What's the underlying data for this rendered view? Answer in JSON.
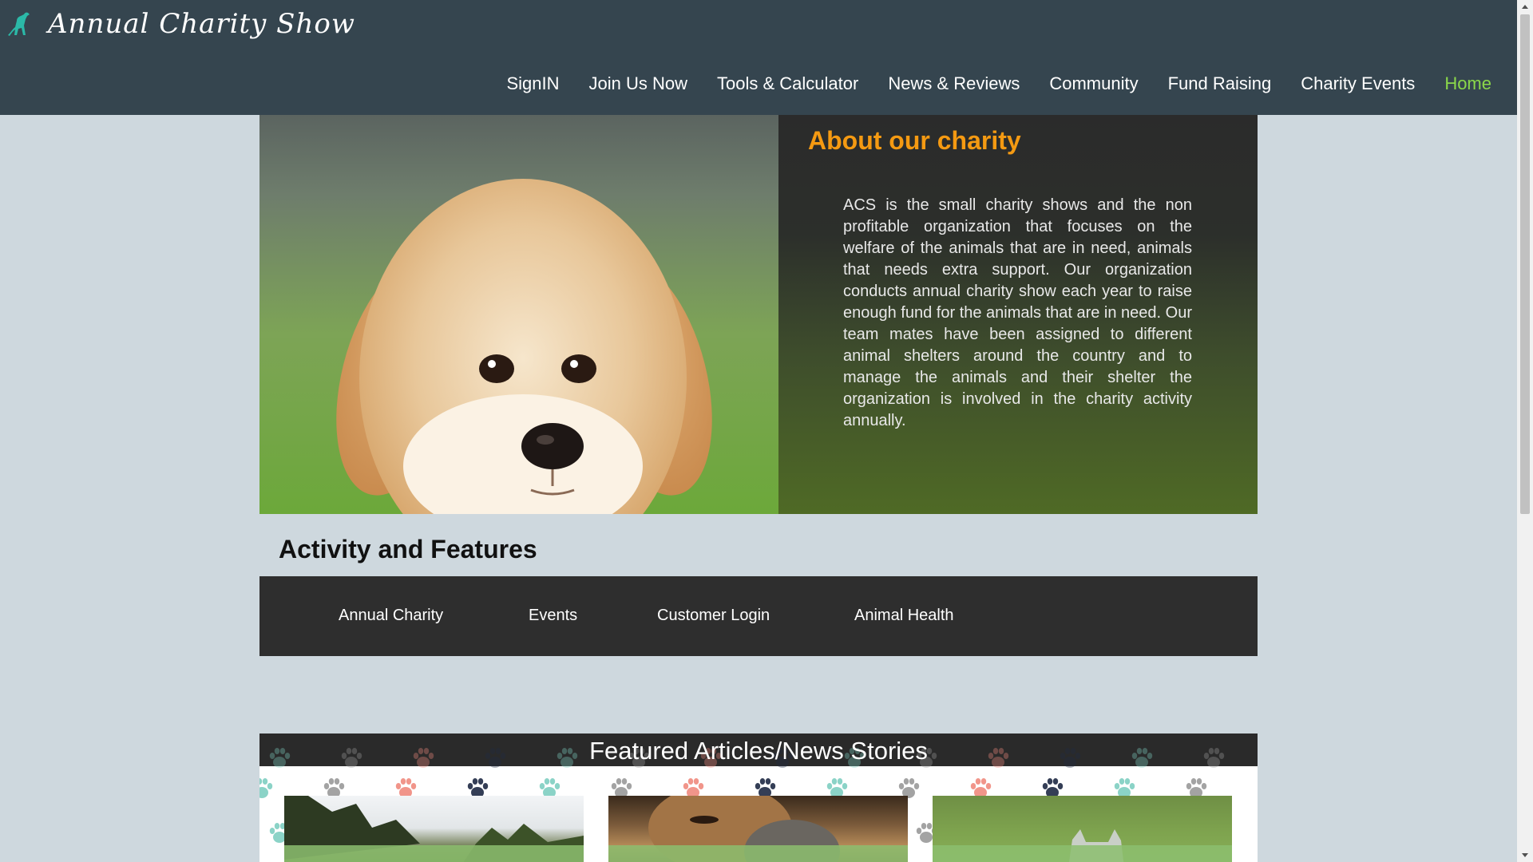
{
  "header": {
    "title": "Annual Charity Show",
    "logo_icon": "dog-icon",
    "background": "#35454f",
    "nav": [
      {
        "label": "SignIN"
      },
      {
        "label": "Join Us Now"
      },
      {
        "label": "Tools & Calculator"
      },
      {
        "label": "News & Reviews"
      },
      {
        "label": "Community"
      },
      {
        "label": "Fund Raising"
      },
      {
        "label": "Charity Events"
      },
      {
        "label": "Home",
        "active": true
      }
    ],
    "active_color": "#8bd84a"
  },
  "hero": {
    "image": "golden-retriever-puppy",
    "title": "About our charity",
    "title_color": "#f59a12",
    "body": "ACS is the small charity shows and the non profitable organization that focuses on the welfare of the animals that are in need, animals that needs extra support. Our organization conducts annual charity show each year to raise enough fund for the animals that are in need. Our team mates have been assigned to different animal shelters around the country and to manage the animals and their shelter the organization is involved in the charity activity annually."
  },
  "activity": {
    "title": "Activity and Features",
    "items": [
      {
        "label": "Annual Charity"
      },
      {
        "label": "Events"
      },
      {
        "label": "Customer Login"
      },
      {
        "label": "Animal Health"
      }
    ]
  },
  "featured": {
    "title": "Featured Articles/News Stories",
    "paw_colors": [
      "#7fcfc1",
      "#9a9a9a",
      "#f08a7e",
      "#1f2a44"
    ],
    "cards": [
      {
        "image": "pine-trees-photo"
      },
      {
        "image": "dog-and-cat-photo"
      },
      {
        "image": "cat-on-grass-photo"
      }
    ]
  }
}
